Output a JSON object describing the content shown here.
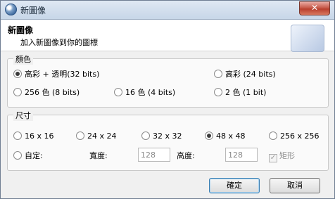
{
  "window": {
    "title": "新圖像",
    "close_label": "✕"
  },
  "header": {
    "title": "新圖像",
    "subtitle": "加入新圖像到你的圖標"
  },
  "color_group": {
    "label": "顏色",
    "options": [
      {
        "label": "高彩 + 透明(32 bits)",
        "checked": true
      },
      {
        "label": "高彩 (24 bits)",
        "checked": false
      },
      {
        "label": "256 色 (8 bits)",
        "checked": false
      },
      {
        "label": "16 色 (4 bits)",
        "checked": false
      },
      {
        "label": "2 色 (1 bit)",
        "checked": false
      }
    ]
  },
  "size_group": {
    "label": "尺寸",
    "options": [
      {
        "label": "16 x 16",
        "checked": false
      },
      {
        "label": "24 x 24",
        "checked": false
      },
      {
        "label": "32 x 32",
        "checked": false
      },
      {
        "label": "48 x 48",
        "checked": true
      },
      {
        "label": "256 x 256",
        "checked": false
      },
      {
        "label": "自定:",
        "checked": false
      }
    ],
    "width_label": "寬度:",
    "width_value": "128",
    "height_label": "高度:",
    "height_value": "128",
    "rectangle_label": "矩形",
    "rectangle_checked": true
  },
  "buttons": {
    "ok": "確定",
    "cancel": "取消"
  },
  "icons": {
    "app": "app-globe-icon",
    "header": "image-preview-icon"
  }
}
